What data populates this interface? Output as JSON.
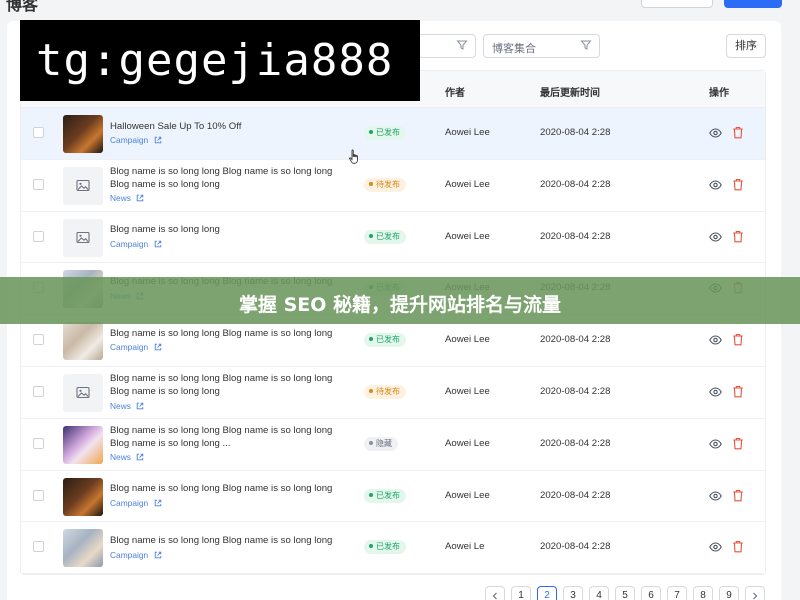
{
  "page": {
    "title": "博客"
  },
  "toolbar": {
    "filter_label": "博客集合",
    "sort_label": "排序"
  },
  "table": {
    "headers": {
      "author": "作者",
      "updated": "最后更新时间",
      "actions": "操作"
    },
    "rows": [
      {
        "title": "Halloween Sale Up To 10% Off",
        "tag": "Campaign",
        "status": "已发布",
        "status_type": "published",
        "author": "Aowei Lee",
        "updated": "2020-08-04 2:28",
        "thumb": "photo"
      },
      {
        "title": "Blog name is so long long Blog name is so long long Blog name is so long long",
        "tag": "News",
        "status": "待发布",
        "status_type": "pending",
        "author": "Aowei Lee",
        "updated": "2020-08-04 2:28",
        "thumb": "placeholder"
      },
      {
        "title": "Blog name is so long long",
        "tag": "Campaign",
        "status": "已发布",
        "status_type": "published",
        "author": "Aowei Lee",
        "updated": "2020-08-04 2:28",
        "thumb": "placeholder"
      },
      {
        "title": "Blog name is so long long Blog name is so long long",
        "tag": "News",
        "status": "已发布",
        "status_type": "published",
        "author": "Aowei Lee",
        "updated": "2020-08-04 2:28",
        "thumb": "photo"
      },
      {
        "title": "Blog name is so long long Blog name is so long long",
        "tag": "Campaign",
        "status": "已发布",
        "status_type": "published",
        "author": "Aowei Lee",
        "updated": "2020-08-04 2:28",
        "thumb": "photo"
      },
      {
        "title": "Blog name is so long long Blog name is so long long Blog name is so long long",
        "tag": "News",
        "status": "待发布",
        "status_type": "pending",
        "author": "Aowei Lee",
        "updated": "2020-08-04 2:28",
        "thumb": "placeholder"
      },
      {
        "title": "Blog name is so long long Blog name is so long long Blog name is so long long ...",
        "tag": "News",
        "status": "隐藏",
        "status_type": "hidden",
        "author": "Aowei Lee",
        "updated": "2020-08-04 2:28",
        "thumb": "photo"
      },
      {
        "title": "Blog name is so long long Blog name is so long long",
        "tag": "Campaign",
        "status": "已发布",
        "status_type": "published",
        "author": "Aowei Lee",
        "updated": "2020-08-04 2:28",
        "thumb": "photo"
      },
      {
        "title": "Blog name is so long long Blog name is so long long",
        "tag": "Campaign",
        "status": "已发布",
        "status_type": "published",
        "author": "Aowei Le",
        "updated": "2020-08-04 2:28",
        "thumb": "photo"
      }
    ]
  },
  "pagination": {
    "pages": [
      "1",
      "2",
      "3",
      "4",
      "5",
      "6",
      "7",
      "8",
      "9"
    ],
    "current": "2"
  },
  "overlays": {
    "watermark": "tg:gegejia888",
    "banner": "掌握 SEO 秘籍，提升网站排名与流量"
  },
  "colors": {
    "accent": "#2b6cf6",
    "link": "#4a82e0",
    "published": "#21a366",
    "pending": "#d9861a",
    "hidden": "#8a919c",
    "delete": "#e5533d",
    "banner": "#6a965c"
  }
}
